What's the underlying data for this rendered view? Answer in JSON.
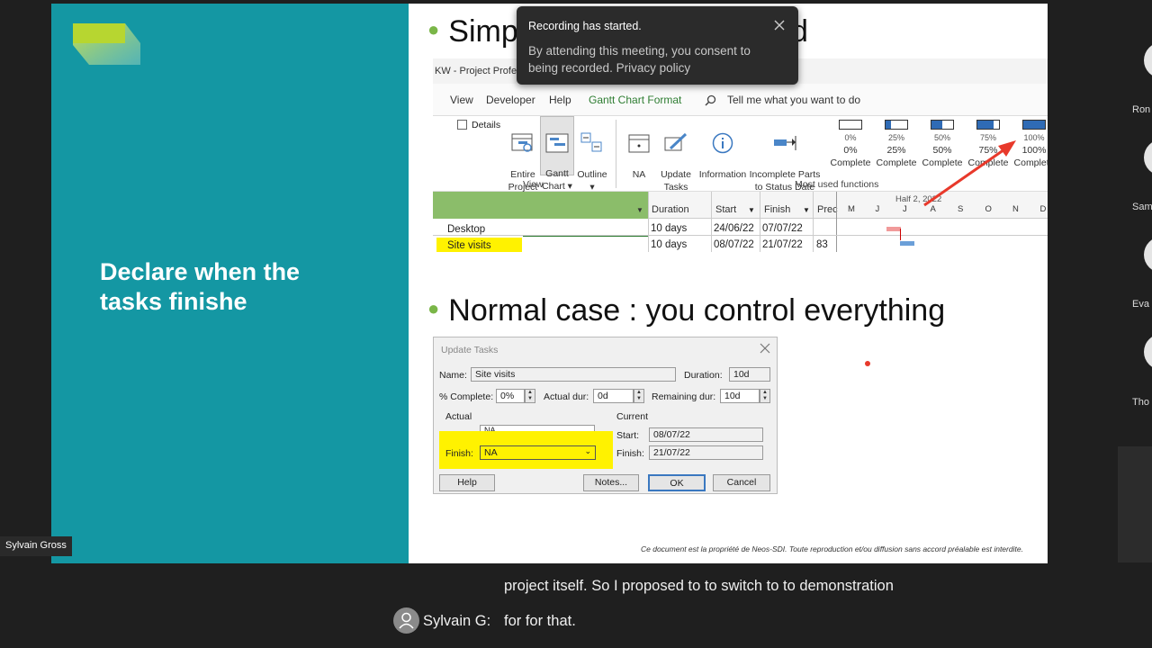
{
  "slide": {
    "heading": "Declare when the\ntasks finishe",
    "bullet1": "Simp",
    "bullet1_tail": "d",
    "bullet2": "Normal case : you control everything",
    "footer_note": "Ce document est la propriété de Neos-SDI. Toute reproduction et/ou diffusion sans accord préalable est interdite."
  },
  "ribbon": {
    "title": "KW - Project Profess",
    "tabs": [
      "View",
      "Developer",
      "Help",
      "Gantt Chart Format"
    ],
    "tell_me": "Tell me what you want to do",
    "details_label": "Details",
    "view_buttons": [
      "Entire\nProject",
      "Gantt\nChart ▾",
      "Outline\n▾"
    ],
    "view_group_label": "View",
    "tool_buttons": [
      "NA",
      "Update\nTasks",
      "Information",
      "Incomplete Parts\nto Status Date"
    ],
    "percent_buttons": [
      {
        "box": "0%",
        "label": "0%\nComplete",
        "fill": 0
      },
      {
        "box": "25%",
        "label": "25%\nComplete",
        "fill": 0.25
      },
      {
        "box": "50%",
        "label": "50%\nComplete",
        "fill": 0.5
      },
      {
        "box": "75%",
        "label": "75%\nComplete",
        "fill": 0.75
      },
      {
        "box": "100%",
        "label": "100%\nComplete",
        "fill": 1
      }
    ],
    "most_used_label": "Most used functions"
  },
  "grid": {
    "headers": [
      "Duration",
      "Start",
      "Finish",
      "Prec"
    ],
    "timescale_top": "Half 2, 2022",
    "timescale_months": [
      "M",
      "J",
      "J",
      "A",
      "S",
      "O",
      "N",
      "D"
    ],
    "rows": [
      {
        "name": "Desktop",
        "duration": "10 days",
        "start": "24/06/22",
        "finish": "07/07/22",
        "pred": ""
      },
      {
        "name": "Site visits",
        "duration": "10 days",
        "start": "08/07/22",
        "finish": "21/07/22",
        "pred": "83"
      }
    ]
  },
  "toast": {
    "title": "Recording has started.",
    "body": "By attending this meeting, you consent to being recorded. Privacy policy"
  },
  "dialog": {
    "title": "Update Tasks",
    "name_label": "Name:",
    "name_value": "Site visits",
    "duration_label": "Duration:",
    "duration_value": "10d",
    "pct_label": "% Complete:",
    "pct_value": "0%",
    "actual_dur_label": "Actual dur:",
    "actual_dur_value": "0d",
    "remaining_label": "Remaining dur:",
    "remaining_value": "10d",
    "actual_group": "Actual",
    "current_group": "Current",
    "actual_start_value": "NA",
    "finish_label": "Finish:",
    "finish_value": "NA",
    "current_start_label": "Start:",
    "current_start_value": "08/07/22",
    "current_finish_label": "Finish:",
    "current_finish_value": "21/07/22",
    "help_btn": "Help",
    "notes_btn": "Notes...",
    "ok_btn": "OK",
    "cancel_btn": "Cancel"
  },
  "participants": [
    "Ron",
    "Sam",
    "Eva",
    "Tho"
  ],
  "presenter_tag": "Sylvain Gross",
  "captions": {
    "line1": "project itself. So I proposed to to switch to to demonstration",
    "speaker": "Sylvain G:",
    "line2": "for for that."
  },
  "colors": {
    "teal": "#1497a3",
    "highlight": "#fff200",
    "arrow": "#e8392b",
    "bullet_green": "#7ab648"
  }
}
